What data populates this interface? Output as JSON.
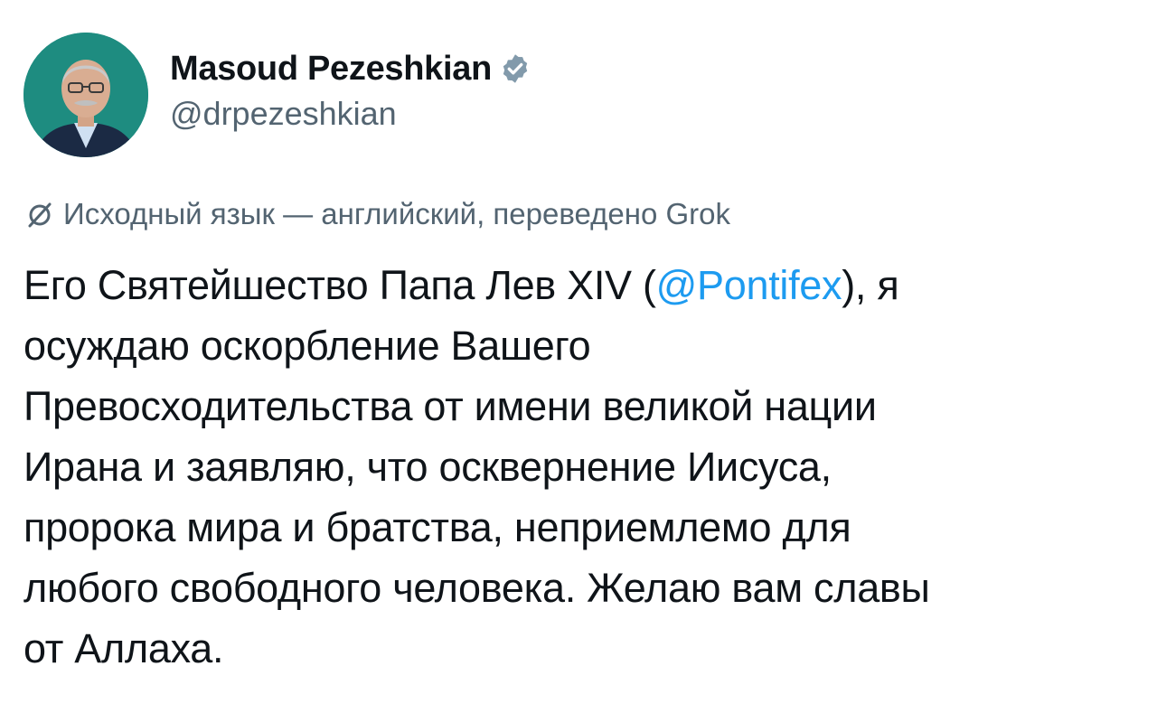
{
  "author": {
    "display_name": "Masoud Pezeshkian",
    "handle": "@drpezeshkian",
    "verified_icon": "verified-badge-icon",
    "avatar_bg": "#1c8a7e"
  },
  "translation_notice": {
    "icon": "translate-slash-icon",
    "text": "Исходный язык — английский, переведено Grok"
  },
  "tweet": {
    "line1_before": "Его Святейшество Папа Лев XIV (",
    "mention": "@Pontifex",
    "line1_after": "), я",
    "line2": "осуждаю оскорбление Вашего",
    "line3": "Превосходительства от имени великой нации",
    "line4": "Ирана и заявляю, что осквернение Иисуса,",
    "line5": "пророка мира и братства, неприемлемо для",
    "line6": "любого свободного человека. Желаю вам славы",
    "line7": "от Аллаха."
  },
  "colors": {
    "mention": "#1d9bf0",
    "secondary_text": "#536471",
    "primary_text": "#0f1419",
    "verified_badge": "#829aab"
  }
}
